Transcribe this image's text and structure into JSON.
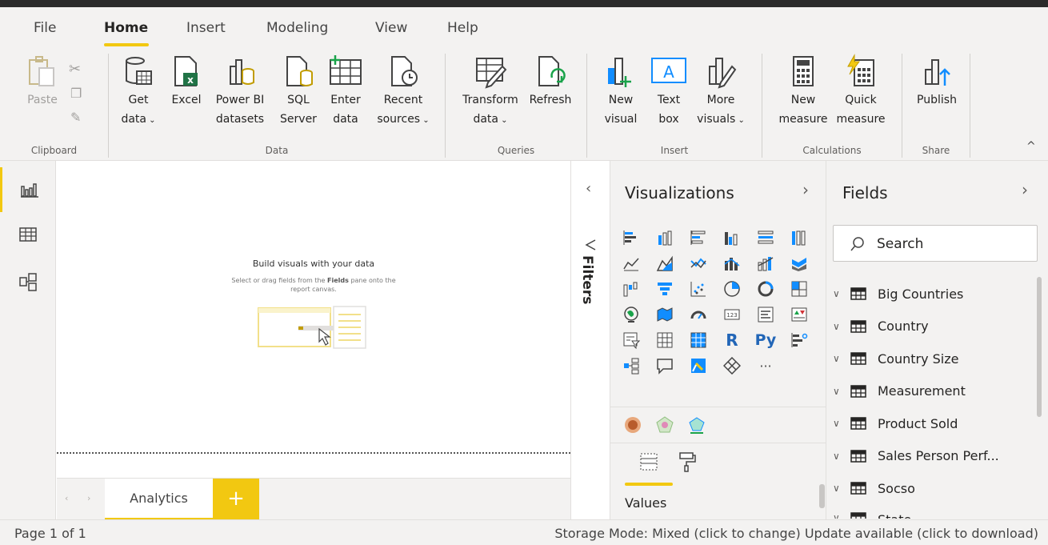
{
  "menu": {
    "tabs": [
      "File",
      "Home",
      "Insert",
      "Modeling",
      "View",
      "Help"
    ],
    "active": "Home"
  },
  "ribbon": {
    "clipboard": {
      "paste": "Paste",
      "group": "Clipboard"
    },
    "data": {
      "get_data": "Get\ndata",
      "excel": "Excel",
      "powerbi": "Power BI\ndatasets",
      "sql": "SQL\nServer",
      "enter": "Enter\ndata",
      "recent": "Recent\nsources",
      "group": "Data"
    },
    "queries": {
      "transform": "Transform\ndata",
      "refresh": "Refresh",
      "group": "Queries"
    },
    "insert": {
      "new_visual": "New\nvisual",
      "text_box": "Text\nbox",
      "more_visuals": "More\nvisuals",
      "group": "Insert"
    },
    "calculations": {
      "new_measure": "New\nmeasure",
      "quick_measure": "Quick\nmeasure",
      "group": "Calculations"
    },
    "share": {
      "publish": "Publish",
      "group": "Share"
    }
  },
  "canvas": {
    "empty_title": "Build visuals with your data",
    "empty_sub_1": "Select or drag fields from the",
    "empty_sub_bold": "Fields",
    "empty_sub_2": "pane onto the report canvas."
  },
  "pages": {
    "tab": "Analytics",
    "add": "+"
  },
  "filters": {
    "label": "Filters"
  },
  "visualizations": {
    "title": "Visualizations",
    "values_label": "Values",
    "more": "···"
  },
  "fields": {
    "title": "Fields",
    "search_placeholder": "Search",
    "tables": [
      "Big Countries",
      "Country",
      "Country Size",
      "Measurement",
      "Product Sold",
      "Sales Person Perf...",
      "Socso",
      "State"
    ]
  },
  "status": {
    "page": "Page 1 of 1",
    "right": "Storage Mode: Mixed (click to change) Update available (click to download)"
  },
  "colors": {
    "accent": "#f2c811",
    "chrome": "#f3f2f1"
  }
}
